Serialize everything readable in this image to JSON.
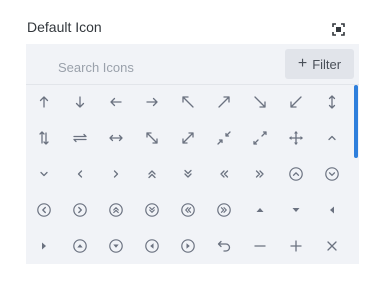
{
  "field": {
    "title": "Default Icon"
  },
  "search": {
    "placeholder": "Search Icons",
    "value": ""
  },
  "filter": {
    "icon": "plus-icon",
    "label": "Filter"
  },
  "header": {
    "focus_icon": "focus-icon"
  },
  "colors": {
    "panel_bg": "#f1f3f7",
    "icon": "#6b7280",
    "scrollbar": "#2e7fdc"
  },
  "icons": [
    [
      "arrow-up",
      "arrow-down",
      "arrow-left",
      "arrow-right",
      "arrow-up-left",
      "arrow-up-right",
      "arrow-down-right",
      "arrow-down-left",
      "arrow-up-down"
    ],
    [
      "arrows-vertical",
      "arrows-swap-horizontal",
      "arrow-left-right",
      "expand-diagonal",
      "expand-diagonal-2",
      "collapse",
      "expand",
      "move",
      "chevron-up"
    ],
    [
      "chevron-down",
      "chevron-left",
      "chevron-right",
      "double-chevron-up",
      "double-chevron-down",
      "double-chevron-left",
      "double-chevron-right",
      "circle-chevron-up",
      "circle-chevron-down"
    ],
    [
      "circle-chevron-left",
      "circle-chevron-right",
      "circle-double-chevron-up",
      "circle-double-chevron-down",
      "circle-double-chevron-left",
      "circle-double-chevron-right",
      "caret-up",
      "caret-down",
      "caret-left"
    ],
    [
      "caret-right",
      "circle-caret-up",
      "circle-caret-down",
      "circle-caret-left",
      "circle-caret-right",
      "undo",
      "minus",
      "plus",
      "close"
    ]
  ]
}
